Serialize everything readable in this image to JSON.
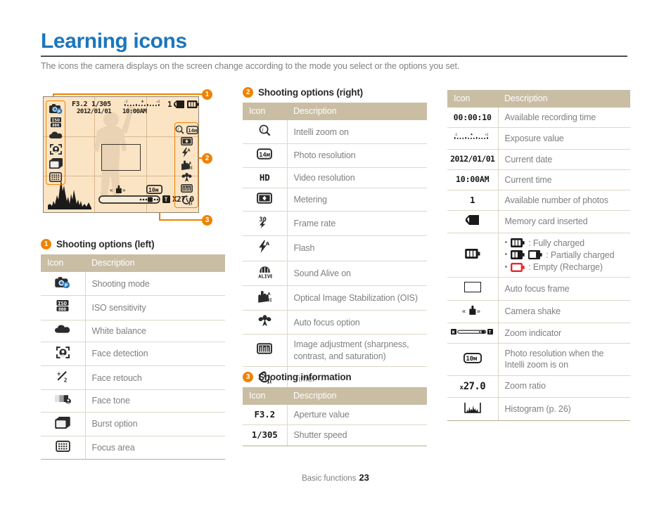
{
  "page": {
    "title": "Learning icons",
    "intro": "The icons the camera displays on the screen change according to the mode you select or the options you set.",
    "footer_label": "Basic functions",
    "footer_page": "23",
    "accent_blue": "#1b76bc",
    "accent_orange": "#ef8200",
    "table_header_bg": "#c9bda4",
    "lcd_bg": "#fbe4c4"
  },
  "lcd": {
    "aperture": "F3.2",
    "shutter": "1/305",
    "date": "2012/01/01",
    "time": "10:00AM",
    "photos_left": "1",
    "zoom_ratio": "X27.0",
    "resolution_badge": "10м",
    "ev_scale_left": "-2",
    "ev_scale_right": "+2",
    "callouts": [
      {
        "num": "1",
        "target": "shooting options (left)"
      },
      {
        "num": "2",
        "target": "shooting options (right)"
      },
      {
        "num": "3",
        "target": "shooting information"
      }
    ],
    "left_icons": [
      "shooting-mode-icon",
      "iso-icon",
      "white-balance-icon",
      "face-detection-icon",
      "burst-icon",
      "focus-area-icon"
    ],
    "right_icons": [
      "intelli-zoom-icon",
      "photo-resolution-icon",
      "metering-icon",
      "flash-icon",
      "ois-icon",
      "macro-icon",
      "image-adjust-icon",
      "timer-icon"
    ]
  },
  "section_left": {
    "badge": "1",
    "heading": "Shooting options (left)",
    "columns": [
      "Icon",
      "Description"
    ],
    "rows": [
      {
        "icon": "shooting-mode-icon",
        "desc": "Shooting mode"
      },
      {
        "icon": "iso-icon",
        "desc": "ISO sensitivity"
      },
      {
        "icon": "white-balance-icon",
        "desc": "White balance"
      },
      {
        "icon": "face-detection-icon",
        "desc": "Face detection"
      },
      {
        "icon": "face-retouch-icon",
        "desc": "Face retouch"
      },
      {
        "icon": "face-tone-icon",
        "desc": "Face tone"
      },
      {
        "icon": "burst-option-icon",
        "desc": "Burst option"
      },
      {
        "icon": "focus-area-icon",
        "desc": "Focus area"
      }
    ]
  },
  "section_mid": {
    "badge": "2",
    "heading": "Shooting options (right)",
    "columns": [
      "Icon",
      "Description"
    ],
    "rows": [
      {
        "icon": "intelli-zoom-icon",
        "desc": "Intelli zoom on"
      },
      {
        "icon": "photo-resolution-icon",
        "desc": "Photo resolution"
      },
      {
        "icon": "video-resolution-icon",
        "desc": "Video resolution"
      },
      {
        "icon": "metering-icon",
        "desc": "Metering"
      },
      {
        "icon": "frame-rate-icon",
        "desc": "Frame rate"
      },
      {
        "icon": "flash-icon",
        "desc": "Flash"
      },
      {
        "icon": "sound-alive-icon",
        "desc": "Sound Alive on"
      },
      {
        "icon": "ois-icon",
        "desc": "Optical Image Stabilization (OIS)"
      },
      {
        "icon": "auto-focus-option-icon",
        "desc": "Auto focus option"
      },
      {
        "icon": "image-adjustment-icon",
        "desc": "Image adjustment (sharpness, contrast, and saturation)"
      },
      {
        "icon": "timer-icon",
        "desc": "Timer"
      }
    ]
  },
  "section_info": {
    "badge": "3",
    "heading": "Shooting information",
    "columns": [
      "Icon",
      "Description"
    ],
    "rows": [
      {
        "icon": "F3.2",
        "desc": "Aperture value"
      },
      {
        "icon": "1/305",
        "desc": "Shutter speed"
      }
    ]
  },
  "section_right": {
    "columns": [
      "Icon",
      "Description"
    ],
    "rows": [
      {
        "icon": "00:00:10",
        "desc": "Available recording time"
      },
      {
        "icon": "exposure-scale-icon",
        "desc": "Exposure value"
      },
      {
        "icon": "2012/01/01",
        "desc": "Current date"
      },
      {
        "icon": "10:00AM",
        "desc": "Current time"
      },
      {
        "icon": "1",
        "desc": "Available number of photos"
      },
      {
        "icon": "memory-card-icon",
        "desc": "Memory card inserted"
      },
      {
        "icon": "battery-icon",
        "desc": "",
        "bullets": [
          {
            "icon": "battery-full-icon",
            "text": ": Fully charged"
          },
          {
            "icon": "battery-partial-icon",
            "text": ": Partially charged"
          },
          {
            "icon": "battery-empty-icon",
            "text": ": Empty (Recharge)"
          }
        ]
      },
      {
        "icon": "auto-focus-frame-icon",
        "desc": "Auto focus frame"
      },
      {
        "icon": "camera-shake-icon",
        "desc": "Camera shake"
      },
      {
        "icon": "zoom-indicator-icon",
        "desc": "Zoom indicator"
      },
      {
        "icon": "photo-resolution-intelli-icon",
        "desc": "Photo resolution when the Intelli zoom is on"
      },
      {
        "icon": "x27.0",
        "desc": "Zoom ratio"
      },
      {
        "icon": "histogram-icon",
        "desc": "Histogram (p. 26)"
      }
    ]
  }
}
